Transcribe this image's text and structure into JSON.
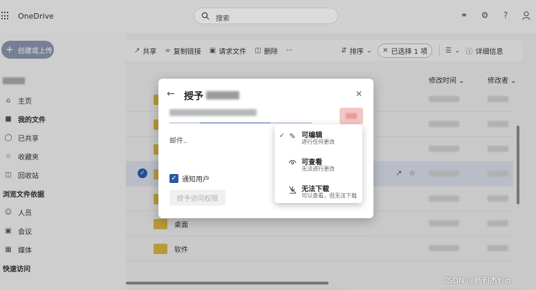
{
  "app": {
    "name": "OneDrive"
  },
  "search": {
    "placeholder": "搜索"
  },
  "sidebar": {
    "create_label": "创建或上传",
    "items": [
      {
        "label": "主页",
        "icon": "home-icon"
      },
      {
        "label": "我的文件",
        "icon": "folder-icon"
      },
      {
        "label": "已共享",
        "icon": "people-icon"
      },
      {
        "label": "收藏夹",
        "icon": "star-icon"
      },
      {
        "label": "回收站",
        "icon": "trash-icon"
      }
    ],
    "browse_heading": "浏览文件依据",
    "browse_items": [
      {
        "label": "人员",
        "icon": "person-icon"
      },
      {
        "label": "会议",
        "icon": "meeting-icon"
      },
      {
        "label": "媒体",
        "icon": "image-icon"
      }
    ],
    "quick_heading": "快速访问"
  },
  "toolbar": {
    "share": "共享",
    "copy_link": "复制链接",
    "request_files": "请求文件",
    "delete": "删除",
    "more": "···",
    "sort": "排序",
    "selected": "已选择 1 项",
    "details": "详细信息"
  },
  "columns": {
    "modified": "修改时间",
    "modified_by": "修改者"
  },
  "rows": [
    {
      "name": ""
    },
    {
      "name": ""
    },
    {
      "name": ""
    },
    {
      "name": ""
    },
    {
      "name": ""
    },
    {
      "name": "桌面"
    },
    {
      "name": "软件"
    }
  ],
  "dialog": {
    "title": "授予",
    "message_label": "邮件..",
    "notify_label": "通知用户",
    "grant_button": "授予访问权限"
  },
  "permission_menu": [
    {
      "title": "可编辑",
      "subtitle": "进行任何更改",
      "icon": "pencil-icon",
      "checked": true
    },
    {
      "title": "可查看",
      "subtitle": "无法进行更改",
      "icon": "eye-icon",
      "checked": false
    },
    {
      "title": "无法下载",
      "subtitle": "可以查看，但无法下载",
      "icon": "no-download-icon",
      "checked": false
    }
  ],
  "watermark": "CSDN @杨利杰Ylio",
  "colors": {
    "accent": "#2a58a8",
    "folder": "#d9b441",
    "create_button": "#8a94ad"
  }
}
